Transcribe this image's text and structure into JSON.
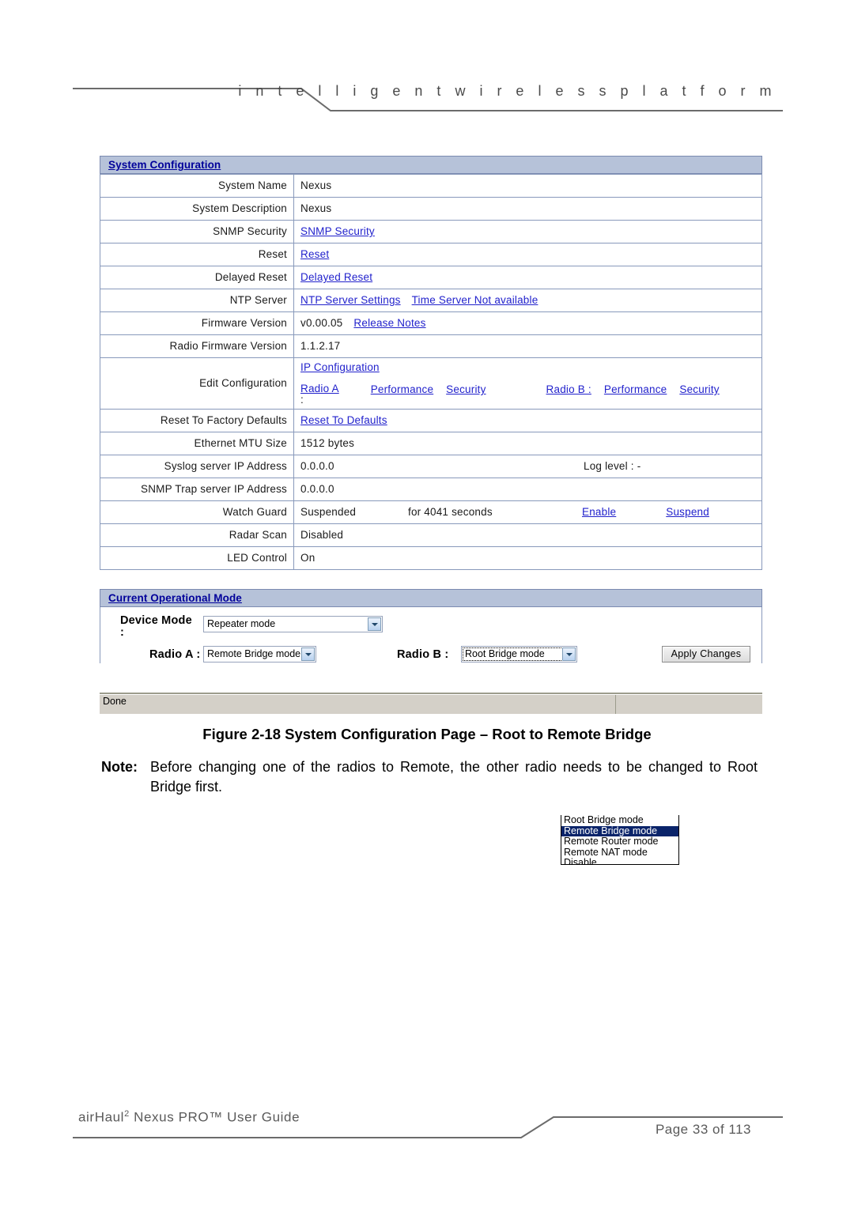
{
  "page_header": {
    "tagline": "i n t e l l i g e n t     w i r e l e s s     p l a t f o r m"
  },
  "screenshot": {
    "system_configuration": {
      "section_title": "System Configuration",
      "rows": [
        {
          "label": "System Name",
          "value": "Nexus"
        },
        {
          "label": "System Description",
          "value": "Nexus"
        },
        {
          "label": "SNMP Security",
          "link": "SNMP Security"
        },
        {
          "label": "Reset",
          "link": "Reset"
        },
        {
          "label": "Delayed Reset",
          "link": "Delayed Reset"
        },
        {
          "label": "NTP Server",
          "link": "NTP Server Settings",
          "link2": "Time Server Not available"
        },
        {
          "label": "Firmware Version",
          "value": "v0.00.05",
          "link": "Release Notes"
        },
        {
          "label": "Radio Firmware Version",
          "value": "1.1.2.17"
        }
      ],
      "edit_configuration": {
        "label": "Edit Configuration",
        "ip_configuration": "IP Configuration",
        "radio_a_label": "Radio A",
        "radio_a_colon": ":",
        "radio_a_performance": "Performance",
        "radio_a_security": "Security",
        "radio_b_label": "Radio B :",
        "radio_b_performance": "Performance",
        "radio_b_security": "Security"
      },
      "rows2": [
        {
          "label": "Reset To Factory Defaults",
          "link": "Reset To Defaults"
        },
        {
          "label": "Ethernet MTU Size",
          "value": "1512 bytes"
        },
        {
          "label": "Syslog server IP Address",
          "value": "0.0.0.0",
          "right": "Log level : -"
        },
        {
          "label": "SNMP Trap server IP Address",
          "value": "0.0.0.0"
        },
        {
          "label": "Watch Guard",
          "value": "Suspended",
          "mid": "for 4041 seconds",
          "link": "Enable",
          "link2": "Suspend"
        },
        {
          "label": "Radar Scan",
          "value": "Disabled"
        },
        {
          "label": "LED Control",
          "value": "On"
        }
      ]
    },
    "operational_mode": {
      "section_title": "Current Operational Mode",
      "device_mode_label": "Device Mode",
      "device_mode_colon": ":",
      "device_mode_value": "Repeater mode",
      "radio_a_label": "Radio A :",
      "radio_a_value": "Remote Bridge mode",
      "radio_b_label": "Radio B :",
      "radio_b_value": "Root Bridge mode",
      "apply_button": "Apply Changes",
      "radio_b_options": [
        {
          "label": "Root Bridge mode",
          "selected": false
        },
        {
          "label": "Remote Bridge mode",
          "selected": true
        },
        {
          "label": "Remote Router mode",
          "selected": false
        },
        {
          "label": "Remote NAT mode",
          "selected": false
        },
        {
          "label": "Disable",
          "selected": false
        }
      ]
    },
    "browser_status": {
      "text": "Done"
    }
  },
  "figure": {
    "caption": "Figure 2-18 System Configuration Page – Root to Remote Bridge"
  },
  "note": {
    "label": "Note:",
    "text": "Before changing one of the radios to Remote, the other radio needs to be changed to Root Bridge first."
  },
  "page_footer": {
    "left_product": "airHaul",
    "left_sup": "2",
    "left_rest": " Nexus PRO™ User Guide",
    "right_page": "Page 33 of 113"
  },
  "colors": {
    "section_bar_bg": "#b6c2d9",
    "link": "#2222cc",
    "section_title": "#00009a",
    "table_border": "#8899bb",
    "dropdown_selected_bg": "#0a246a"
  }
}
